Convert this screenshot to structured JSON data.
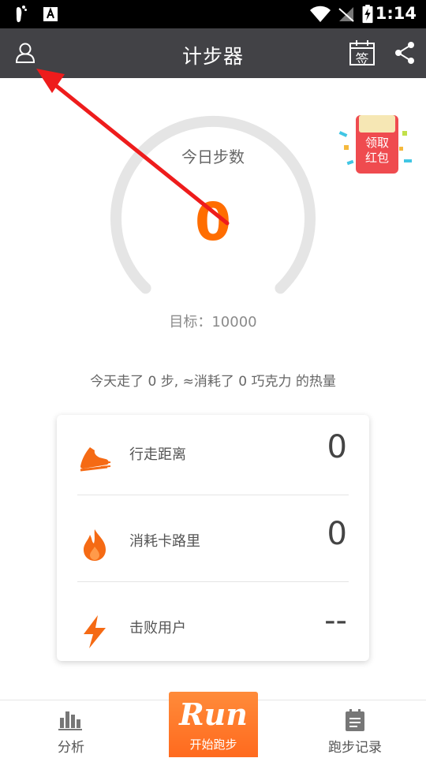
{
  "status_bar": {
    "time": "1:14",
    "icons": [
      "footprint-icon",
      "keyboard-a-icon",
      "wifi-icon",
      "no-signal-icon",
      "battery-charging-icon"
    ]
  },
  "app_bar": {
    "title": "计步器",
    "profile_icon": "person-icon",
    "checkin_label": "签",
    "share_icon": "share-icon",
    "background": "#424246"
  },
  "pedometer": {
    "label": "今日步数",
    "steps": "0",
    "goal": "目标：10000",
    "accent": "#ff6d00"
  },
  "red_packet": {
    "label_line1": "领取",
    "label_line2": "红包"
  },
  "summary": "今天走了 0 步, ≈消耗了 0 巧克力 的热量",
  "stats": [
    {
      "label": "行走距离",
      "value": "0",
      "icon": "running-shoe-icon"
    },
    {
      "label": "消耗卡路里",
      "value": "0",
      "icon": "flame-icon"
    },
    {
      "label": "击败用户",
      "value": "--",
      "icon": "lightning-icon"
    }
  ],
  "tabs": {
    "analysis": "分析",
    "run_logo": "Run",
    "run_label": "开始跑步",
    "records": "跑步记录"
  }
}
